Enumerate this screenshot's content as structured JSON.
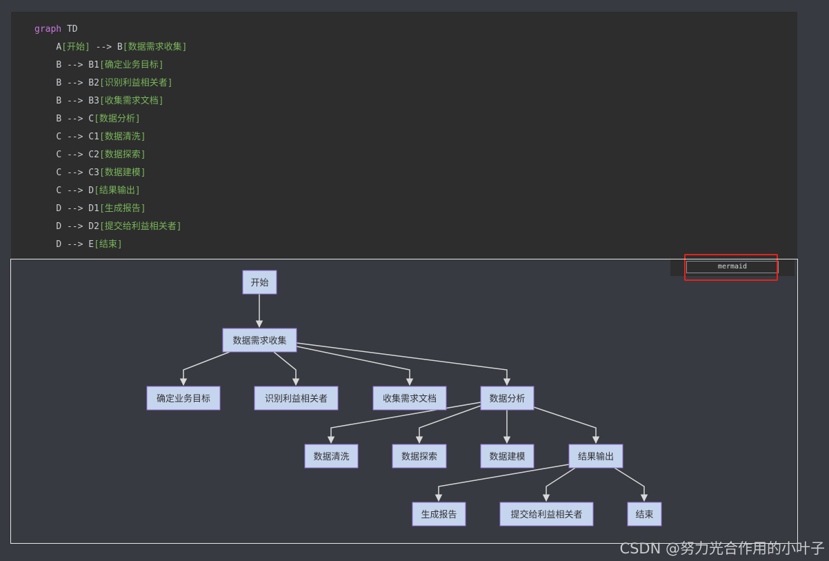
{
  "code": {
    "header_keyword": "graph",
    "header_direction": "TD",
    "lines": [
      {
        "from": "",
        "to": "A",
        "label": "[开始]",
        "post": " --> B",
        "post_label": "[数据需求收集]"
      },
      {
        "from": "B --> ",
        "to": "B1",
        "label": "[确定业务目标]"
      },
      {
        "from": "B --> ",
        "to": "B2",
        "label": "[识别利益相关者]"
      },
      {
        "from": "B --> ",
        "to": "B3",
        "label": "[收集需求文档]"
      },
      {
        "from": "B --> ",
        "to": "C",
        "label": "[数据分析]"
      },
      {
        "from": "C --> ",
        "to": "C1",
        "label": "[数据清洗]"
      },
      {
        "from": "C --> ",
        "to": "C2",
        "label": "[数据探索]"
      },
      {
        "from": "C --> ",
        "to": "C3",
        "label": "[数据建模]"
      },
      {
        "from": "C --> ",
        "to": "D",
        "label": "[结果输出]"
      },
      {
        "from": "D --> ",
        "to": "D1",
        "label": "[生成报告]"
      },
      {
        "from": "D --> ",
        "to": "D2",
        "label": "[提交给利益相关者]"
      },
      {
        "from": "D --> ",
        "to": "E",
        "label": "[结束]"
      }
    ]
  },
  "language_tag": "mermaid",
  "diagram": {
    "nodes": {
      "A": "开始",
      "B": "数据需求收集",
      "B1": "确定业务目标",
      "B2": "识别利益相关者",
      "B3": "收集需求文档",
      "C": "数据分析",
      "C1": "数据清洗",
      "C2": "数据探索",
      "C3": "数据建模",
      "D": "结果输出",
      "D1": "生成报告",
      "D2": "提交给利益相关者",
      "E": "结束"
    },
    "edges": [
      [
        "A",
        "B"
      ],
      [
        "B",
        "B1"
      ],
      [
        "B",
        "B2"
      ],
      [
        "B",
        "B3"
      ],
      [
        "B",
        "C"
      ],
      [
        "C",
        "C1"
      ],
      [
        "C",
        "C2"
      ],
      [
        "C",
        "C3"
      ],
      [
        "C",
        "D"
      ],
      [
        "D",
        "D1"
      ],
      [
        "D",
        "D2"
      ],
      [
        "D",
        "E"
      ]
    ],
    "node_fill": "#c6d5ee",
    "node_stroke": "#9370db",
    "edge_color": "#d9d9d9"
  },
  "watermark": "CSDN @努力光合作用的小叶子",
  "colors": {
    "keyword": "#c678dd",
    "string": "#79b55a",
    "highlight_frame": "#e8221c"
  }
}
